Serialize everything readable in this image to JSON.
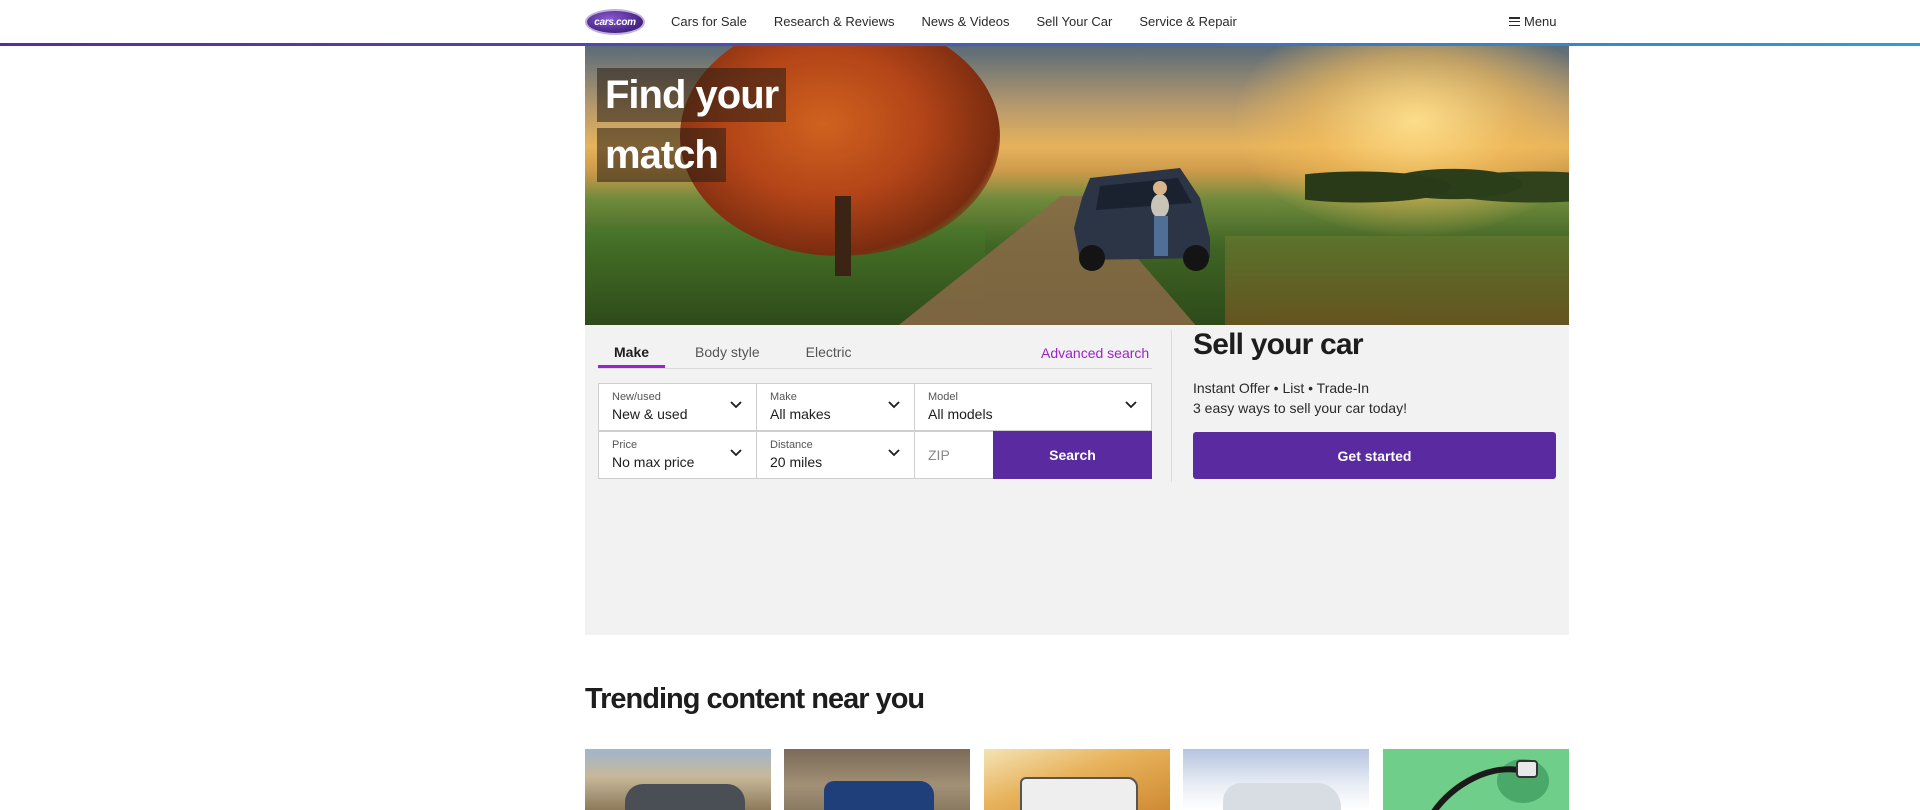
{
  "header": {
    "logo_text": "cars.com",
    "nav": [
      "Cars for Sale",
      "Research & Reviews",
      "News & Videos",
      "Sell Your Car",
      "Service & Repair"
    ],
    "menu_label": "Menu"
  },
  "hero": {
    "title_line1": "Find your",
    "title_line2": "match"
  },
  "search": {
    "tabs": [
      "Make",
      "Body style",
      "Electric"
    ],
    "active_tab": "Make",
    "advanced_link": "Advanced search",
    "new_used": {
      "label": "New/used",
      "value": "New & used"
    },
    "make": {
      "label": "Make",
      "value": "All makes"
    },
    "model": {
      "label": "Model",
      "value": "All models"
    },
    "price": {
      "label": "Price",
      "value": "No max price"
    },
    "distance": {
      "label": "Distance",
      "value": "20 miles"
    },
    "zip_placeholder": "ZIP",
    "search_button": "Search"
  },
  "sell": {
    "title": "Sell your car",
    "line1": "Instant Offer • List • Trade-In",
    "line2": "3 easy ways to sell your car today!",
    "button": "Get started"
  },
  "trending": {
    "title": "Trending content near you"
  },
  "colors": {
    "brand_purple": "#5a2ba0",
    "accent_magenta": "#9b24c4"
  }
}
